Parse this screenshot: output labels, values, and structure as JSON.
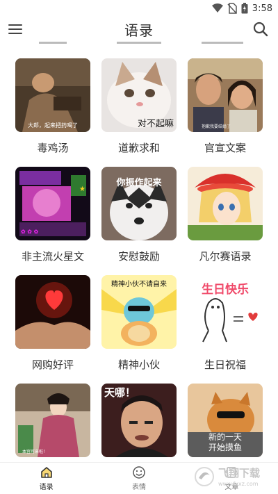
{
  "status_bar": {
    "time": "3:58"
  },
  "app_bar": {
    "title": "语录"
  },
  "cards": [
    {
      "label": "毒鸡汤",
      "caption": "大郎，起来把药喝了"
    },
    {
      "label": "道歉求和",
      "caption": "对不起嘛"
    },
    {
      "label": "官宣文案",
      "caption": "抱歉我要结婚了"
    },
    {
      "label": "非主流火星文",
      "caption": ""
    },
    {
      "label": "安慰鼓励",
      "caption": "你振作起来"
    },
    {
      "label": "凡尔赛语录",
      "caption": ""
    },
    {
      "label": "网购好评",
      "caption": ""
    },
    {
      "label": "精神小伙",
      "caption": "精神小伙不请自来"
    },
    {
      "label": "生日祝福",
      "caption": "生日快乐"
    },
    {
      "label": "",
      "caption": "本宫可来啦！"
    },
    {
      "label": "",
      "caption": "天哪！"
    },
    {
      "label": "",
      "caption": "新的一天\n开始摸鱼"
    }
  ],
  "bottom_nav": {
    "items": [
      {
        "label": "语录",
        "icon": "home-icon",
        "active": true
      },
      {
        "label": "表情",
        "icon": "smile-icon",
        "active": false
      },
      {
        "label": "文章",
        "icon": "article-icon",
        "active": false
      }
    ]
  },
  "watermark": {
    "text": "飞翔下载",
    "sub": "www.fxxz.com"
  },
  "colors": {
    "accent": "#333333",
    "pink": "#f04a6a",
    "nav_text": "#777777"
  }
}
